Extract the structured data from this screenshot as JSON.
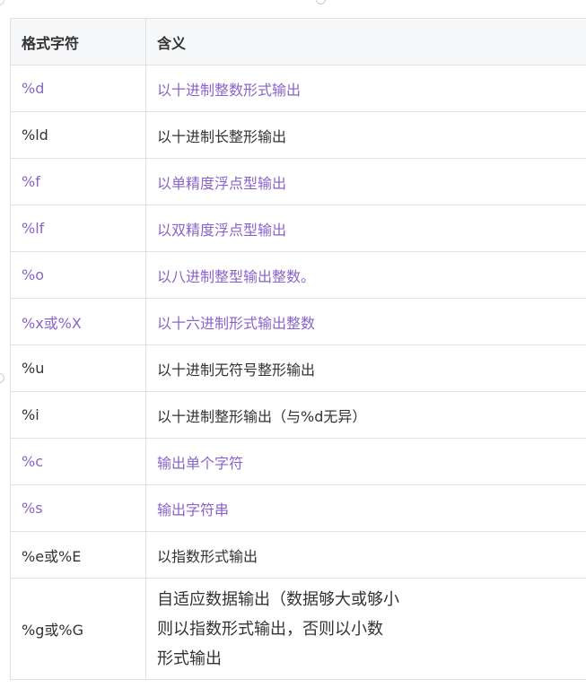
{
  "table": {
    "headers": [
      "格式字符",
      "含义"
    ],
    "rows": [
      {
        "code": "%d",
        "meaning": "以十进制整数形式输出",
        "highlight": true
      },
      {
        "code": "%ld",
        "meaning": "以十进制长整形输出",
        "highlight": false
      },
      {
        "code": "%f",
        "meaning": "以单精度浮点型输出",
        "highlight": true
      },
      {
        "code": "%lf",
        "meaning": "以双精度浮点型输出",
        "highlight": true
      },
      {
        "code": "%o",
        "meaning": "以八进制整型输出整数。",
        "highlight": true
      },
      {
        "code": "%x或%X",
        "meaning": "以十六进制形式输出整数",
        "highlight": true
      },
      {
        "code": "%u",
        "meaning": "以十进制无符号整形输出",
        "highlight": false
      },
      {
        "code": "%i",
        "meaning": "以十进制整形输出（与%d无异）",
        "highlight": false
      },
      {
        "code": "%c",
        "meaning": "输出单个字符",
        "highlight": true
      },
      {
        "code": "%s",
        "meaning": "输出字符串",
        "highlight": true
      },
      {
        "code": "%e或%E",
        "meaning": "以指数形式输出",
        "highlight": false
      },
      {
        "code": "%g或%G",
        "meaning_lines": [
          "自适应数据输出（数据够大或够小",
          "则以指数形式输出，否则以小数",
          "形式输出"
        ],
        "highlight": false
      }
    ]
  },
  "colors": {
    "highlight_text": "#8a63c8",
    "normal_text": "#333333",
    "header_bg": "#f6f7f9",
    "border": "#e2e2e2"
  }
}
